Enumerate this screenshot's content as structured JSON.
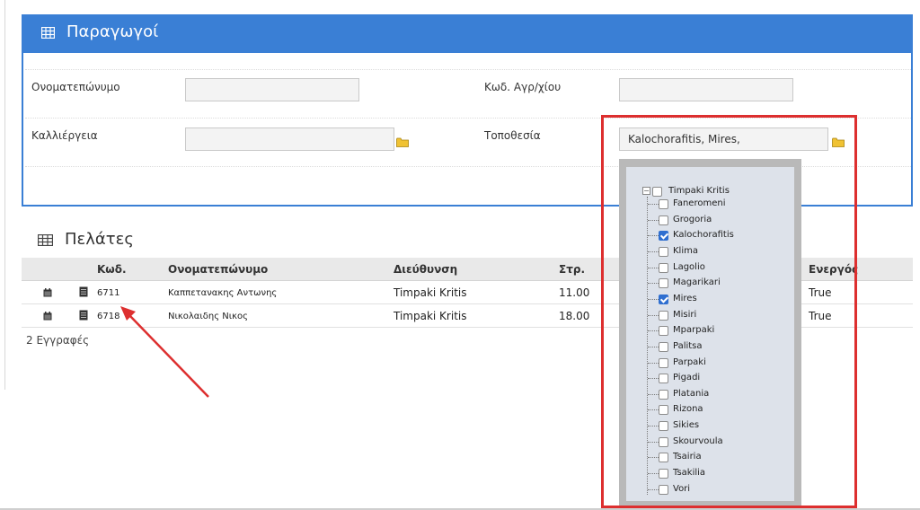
{
  "producers": {
    "title": "Παραγωγοί",
    "fields": {
      "fullname_label": "Ονοματεπώνυμο",
      "fullname_value": "",
      "field_code_label": "Κωδ. Αγρ/χίου",
      "field_code_value": "",
      "crop_label": "Καλλιέργεια",
      "crop_value": "",
      "location_label": "Τοποθεσία",
      "location_value": "Kalochorafitis, Mires,"
    }
  },
  "customers": {
    "title": "Πελάτες",
    "columns": [
      "Κωδ.",
      "Ονοματεπώνυμο",
      "Διεύθυνση",
      "Στρ.",
      "Ενεργός"
    ],
    "rows": [
      {
        "code": "6711",
        "name": "Καππετανακης Αντωνης",
        "address": "Timpaki Kritis",
        "area": "11.00",
        "active": "True"
      },
      {
        "code": "6718",
        "name": "Νικολαιδης Νικος",
        "address": "Timpaki Kritis",
        "area": "18.00",
        "active": "True"
      }
    ],
    "records": "2 Εγγραφές"
  },
  "location_tree": {
    "root": "Timpaki Kritis",
    "root_checked": false,
    "items": [
      {
        "label": "Faneromeni",
        "checked": false
      },
      {
        "label": "Grogoria",
        "checked": false
      },
      {
        "label": "Kalochorafitis",
        "checked": true
      },
      {
        "label": "Klima",
        "checked": false
      },
      {
        "label": "Lagolio",
        "checked": false
      },
      {
        "label": "Magarikari",
        "checked": false
      },
      {
        "label": "Mires",
        "checked": true
      },
      {
        "label": "Misiri",
        "checked": false
      },
      {
        "label": "Mparpaki",
        "checked": false
      },
      {
        "label": "Palitsa",
        "checked": false
      },
      {
        "label": "Parpaki",
        "checked": false
      },
      {
        "label": "Pigadi",
        "checked": false
      },
      {
        "label": "Platania",
        "checked": false
      },
      {
        "label": "Rizona",
        "checked": false
      },
      {
        "label": "Sikies",
        "checked": false
      },
      {
        "label": "Skourvoula",
        "checked": false
      },
      {
        "label": "Tsairia",
        "checked": false
      },
      {
        "label": "Tsakilia",
        "checked": false
      },
      {
        "label": "Vori",
        "checked": false
      }
    ]
  },
  "colors": {
    "header_blue": "#3a7fd5",
    "annotation_red": "#dd2f2f",
    "folder_yellow": "#f0c233",
    "checkbox_blue": "#2f6fd0"
  },
  "icons": [
    "table-icon",
    "folder-icon",
    "calendar-icon",
    "document-icon",
    "tree-collapse-icon"
  ]
}
